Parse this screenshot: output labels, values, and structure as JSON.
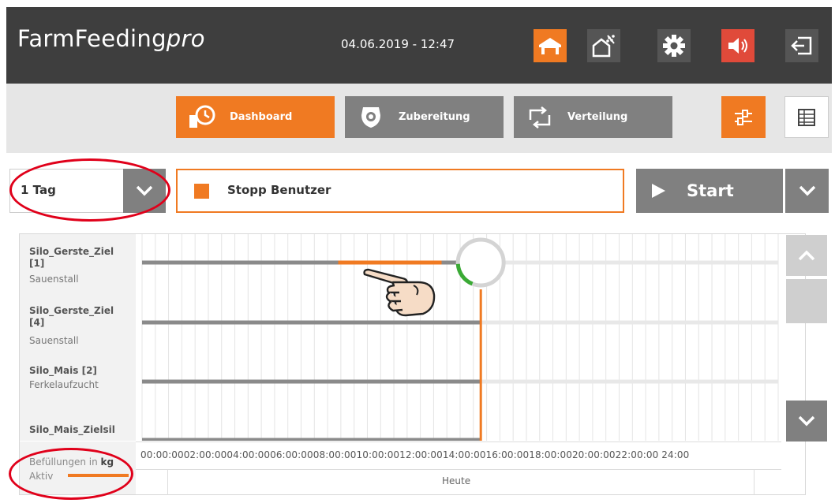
{
  "header": {
    "brand_main": "FarmFeeding",
    "brand_suffix": "pro",
    "datetime": "04.06.2019 - 12:47",
    "buttons": [
      {
        "name": "home-icon",
        "color": "#f07a22"
      },
      {
        "name": "barn-grain-icon",
        "color": "#555555"
      },
      {
        "name": "gear-icon",
        "color": "#555555"
      },
      {
        "name": "speaker-icon",
        "color": "#e04a3a"
      },
      {
        "name": "logout-icon",
        "color": "#555555"
      }
    ]
  },
  "nav": {
    "tabs": [
      {
        "label": "Dashboard",
        "icon": "clock-feeder-icon",
        "active": true
      },
      {
        "label": "Zubereitung",
        "icon": "scale-icon",
        "active": false
      },
      {
        "label": "Verteilung",
        "icon": "repeat-icon",
        "active": false
      }
    ],
    "settings_icon": "sliders-icon",
    "table_icon": "table-grid-icon"
  },
  "controls": {
    "range_value": "1 Tag",
    "status_label": "Stopp Benutzer",
    "start_label": "Start"
  },
  "silos": [
    {
      "name_line1": "Silo_Gerste_Ziel",
      "name_line2": "[1]",
      "location": "Sauenstall"
    },
    {
      "name_line1": "Silo_Gerste_Ziel",
      "name_line2": "[4]",
      "location": "Sauenstall"
    },
    {
      "name_line1": "Silo_Mais [2]",
      "name_line2": "",
      "location": "Ferkelaufzucht"
    },
    {
      "name_line1": "Silo_Mais_Zielsil",
      "name_line2": "",
      "location": ""
    }
  ],
  "timeline": {
    "ticks": "00:00:0002:00:0004:00:0006:00:0008:00:0010:00:0012:00:0014:00:0016:00:0018:00:0020:00:0022:00:00 24:00",
    "day_label": "Heute",
    "current_hour": 12.78,
    "active_window_hours": [
      7.4,
      11.3
    ]
  },
  "legend": {
    "fill_label": "Befüllungen in ",
    "fill_unit": "kg",
    "active_label": "Aktiv"
  },
  "colors": {
    "accent": "#f07a22",
    "header": "#3e3e3e",
    "button_gray": "#808080",
    "progress_green": "#3aaa35"
  }
}
